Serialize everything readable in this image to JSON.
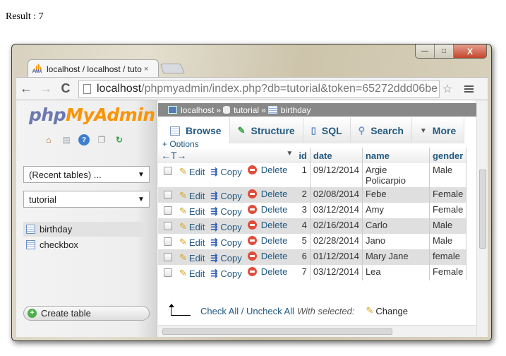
{
  "page": {
    "result_text": "Result : 7"
  },
  "window": {
    "controls": {
      "minimize": "—",
      "maximize": "□",
      "close": "X"
    }
  },
  "browser": {
    "tab": {
      "favicon_label": "PMA",
      "title": "localhost / localhost / tuto",
      "close_icon": "×"
    },
    "nav": {
      "back_icon": "←",
      "forward_icon": "→",
      "reload_icon": "C"
    },
    "url": {
      "host": "localhost",
      "path": "/phpmyadmin/index.php?db=tutorial&token=65272ddd06be"
    },
    "star_icon": "☆"
  },
  "sidebar": {
    "logo": {
      "php": "php",
      "myadmin": "MyAdmin"
    },
    "icons": [
      "home-icon",
      "database-icon",
      "help-icon",
      "documentation-icon",
      "reload-icon"
    ],
    "recent_tables": "(Recent tables) ...",
    "database_select": "tutorial",
    "tables": [
      {
        "name": "birthday",
        "active": true
      },
      {
        "name": "checkbox",
        "active": false
      }
    ],
    "create_table": "Create table"
  },
  "main": {
    "breadcrumb": {
      "server": "localhost",
      "sep": "»",
      "database": "tutorial",
      "table": "birthday"
    },
    "tabs": [
      {
        "label": "Browse",
        "active": true
      },
      {
        "label": "Structure",
        "active": false
      },
      {
        "label": "SQL",
        "active": false
      },
      {
        "label": "Search",
        "active": false
      },
      {
        "label": "More",
        "active": false
      }
    ],
    "options_link": "+ Options",
    "table": {
      "columns": [
        "id",
        "date",
        "name",
        "gender"
      ],
      "actions": {
        "edit": "Edit",
        "copy": "Copy",
        "delete": "Delete"
      },
      "rows": [
        {
          "id": "1",
          "date": "09/12/2014",
          "name": "Argie Policarpio",
          "gender": "Male"
        },
        {
          "id": "2",
          "date": "02/08/2014",
          "name": "Febe",
          "gender": "Female"
        },
        {
          "id": "3",
          "date": "03/12/2014",
          "name": "Amy",
          "gender": "Female"
        },
        {
          "id": "4",
          "date": "02/16/2014",
          "name": "Carlo",
          "gender": "Male"
        },
        {
          "id": "5",
          "date": "02/28/2014",
          "name": "Jano",
          "gender": "Male"
        },
        {
          "id": "6",
          "date": "01/12/2014",
          "name": "Mary Jane",
          "gender": "female"
        },
        {
          "id": "7",
          "date": "03/12/2014",
          "name": "Lea",
          "gender": "Female"
        }
      ]
    },
    "footer": {
      "check_all": "Check All / Uncheck All",
      "with_selected": "With selected:",
      "change": "Change"
    }
  },
  "colors": {
    "link": "#235a81",
    "logo_php": "#6c78af",
    "logo_myadmin": "#f89406",
    "breadcrumb_bg": "#888888"
  }
}
